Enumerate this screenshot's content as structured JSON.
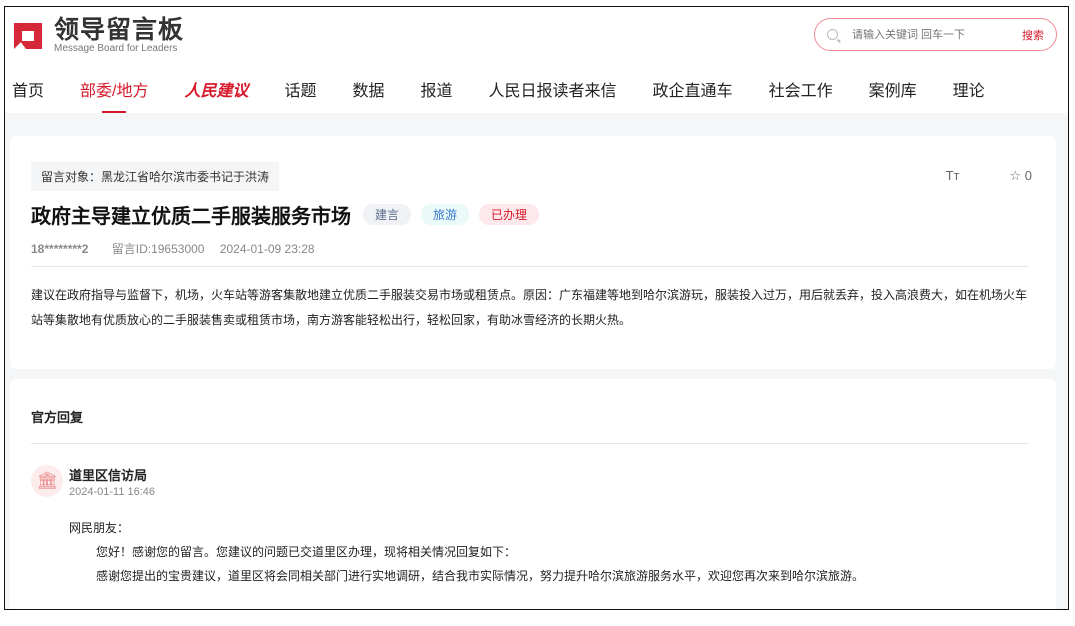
{
  "logo": {
    "cn": "领导留言板",
    "en": "Message Board for Leaders"
  },
  "search": {
    "placeholder": "请输入关键词 回车一下",
    "button": "搜索"
  },
  "nav": [
    "首页",
    "部委/地方",
    "人民建议",
    "话题",
    "数据",
    "报道",
    "人民日报读者来信",
    "政企直通车",
    "社会工作",
    "案例库",
    "理论"
  ],
  "message": {
    "target": "留言对象：黑龙江省哈尔滨市委书记于洪涛",
    "font_tool": "Tт",
    "favorite_count": "0",
    "title": "政府主导建立优质二手服装服务市场",
    "tags": [
      "建言",
      "旅游",
      "已办理"
    ],
    "user": "18********2",
    "id": "留言ID:19653000",
    "date": "2024-01-09 23:28",
    "body": "建议在政府指导与监督下，机场，火车站等游客集散地建立优质二手服装交易市场或租赁点。原因：广东福建等地到哈尔滨游玩，服装投入过万，用后就丢弃，投入高浪费大，如在机场火车站等集散地有优质放心的二手服装售卖或租赁市场，南方游客能轻松出行，轻松回家，有助冰雪经济的长期火热。"
  },
  "reply": {
    "heading": "官方回复",
    "org": "道里区信访局",
    "date": "2024-01-11 16:46",
    "greeting": "网民朋友：",
    "lines": [
      "您好！感谢您的留言。您建议的问题已交道里区办理，现将相关情况回复如下：",
      "感谢您提出的宝贵建议，道里区将会同相关部门进行实地调研，结合我市实际情况，努力提升哈尔滨旅游服务水平，欢迎您再次来到哈尔滨旅游。"
    ]
  },
  "colors": {
    "accent": "#d7182a"
  }
}
